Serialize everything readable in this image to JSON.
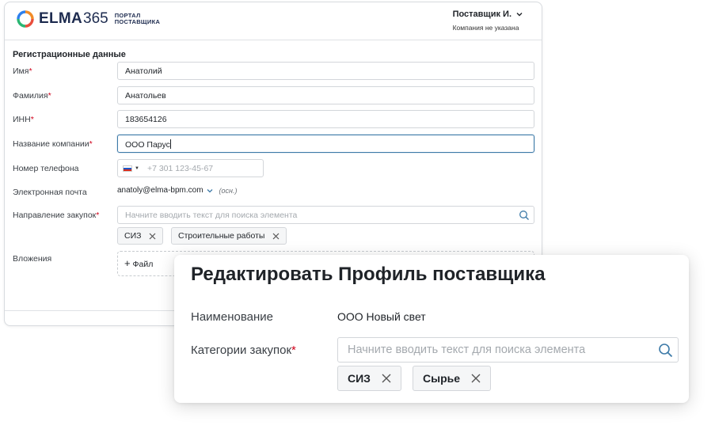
{
  "header": {
    "logo_word": "ELMA",
    "logo_num": "365",
    "logo_sub_1": "ПОРТАЛ",
    "logo_sub_2": "ПОСТАВЩИКА",
    "user_name": "Поставщик И.",
    "company": "Компания не указана"
  },
  "form": {
    "section_title": "Регистрационные данные",
    "first_name": {
      "label": "Имя",
      "value": "Анатолий"
    },
    "last_name": {
      "label": "Фамилия",
      "value": "Анатольев"
    },
    "inn": {
      "label": "ИНН",
      "value": "183654126"
    },
    "company_name": {
      "label": "Название компании",
      "value": "ООО Парус"
    },
    "phone": {
      "label": "Номер телефона",
      "placeholder": "+7 301 123-45-67"
    },
    "email": {
      "label": "Электронная почта",
      "value": "anatoly@elma-bpm.com",
      "note": "(осн.)"
    },
    "purchase_direction": {
      "label": "Направление закупок",
      "placeholder": "Начните вводить текст для поиска элемента",
      "tags": [
        "СИЗ",
        "Строительные работы"
      ]
    },
    "attachments": {
      "label": "Вложения",
      "add_label": "Файл"
    }
  },
  "modal": {
    "title": "Редактировать Профиль поставщика",
    "name_label": "Наименование",
    "name_value": "ООО Новый свет",
    "categories_label": "Категории закупок",
    "categories_placeholder": "Начните вводить текст для поиска элемента",
    "tags": [
      "СИЗ",
      "Сырье"
    ]
  },
  "colors": {
    "required": "#d0021b",
    "focus_border": "#3d7aa8",
    "logo_navy": "#1d2b4f"
  }
}
